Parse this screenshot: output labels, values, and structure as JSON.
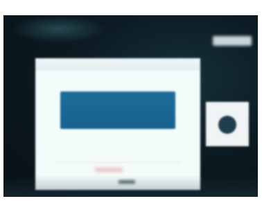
{
  "window": {
    "title": ""
  },
  "dialog": {
    "value_text": "",
    "caption": ""
  },
  "status": {
    "label": ""
  },
  "colors": {
    "background": "#0c1a22",
    "dialog": "#f4fbfb",
    "value_panel": "#1d6d9a",
    "accent_mark": "#e8c2c4"
  },
  "icons": {
    "side_widget": "knob-icon"
  }
}
